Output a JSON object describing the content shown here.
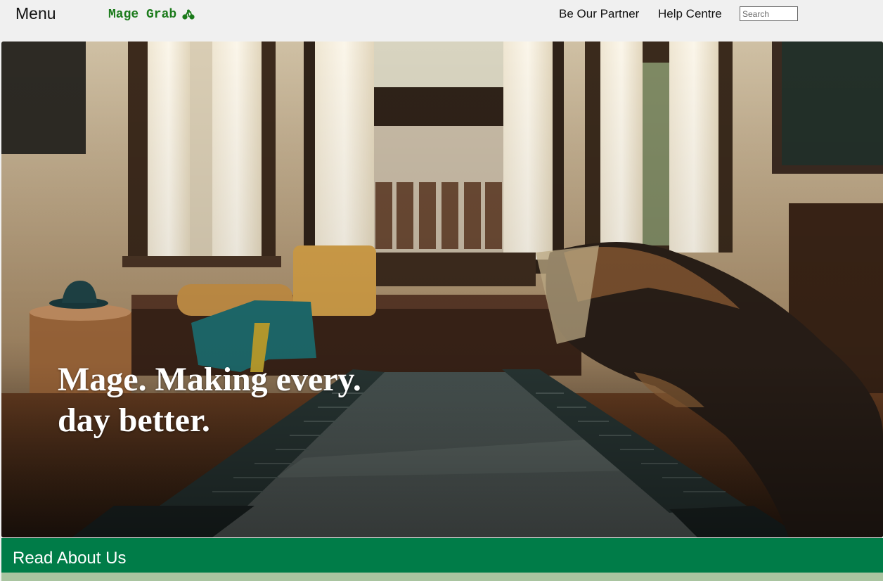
{
  "header": {
    "menu_label": "Menu",
    "brand_name": "Mage Grab",
    "brand_icon": "bicycle-icon",
    "links": [
      "Be Our Partner",
      "Help Centre"
    ],
    "search_placeholder": "Search"
  },
  "hero": {
    "headline_line1": "Mage. Making every.",
    "headline_line2": "day better."
  },
  "about": {
    "label": "Read About Us"
  },
  "colors": {
    "brand_green": "#1a7a1a",
    "about_bar": "#007c48",
    "about_strip": "#a9c4a0"
  }
}
